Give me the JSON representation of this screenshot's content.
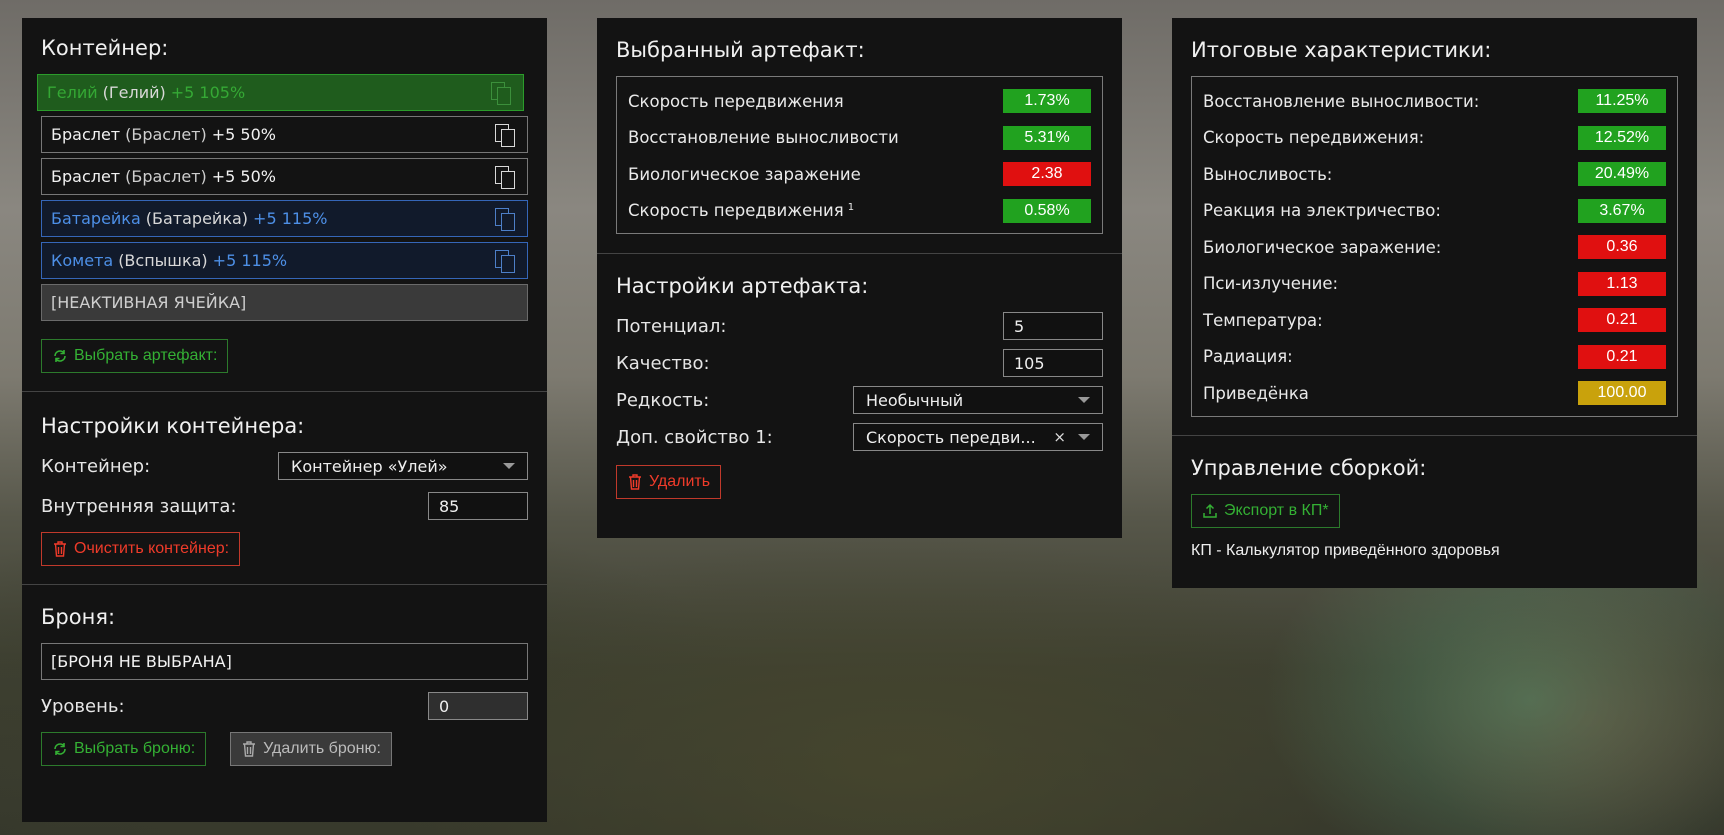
{
  "container_panel": {
    "title": "Контейнер:",
    "slots": [
      {
        "name": "Гелий",
        "sub": "(Гелий)",
        "bonus": "+5 105%",
        "style": "green"
      },
      {
        "name": "Браслет",
        "sub": "(Браслет)",
        "bonus": "+5 50%",
        "style": "plain"
      },
      {
        "name": "Браслет",
        "sub": "(Браслет)",
        "bonus": "+5 50%",
        "style": "plain"
      },
      {
        "name": "Батарейка",
        "sub": "(Батарейка)",
        "bonus": "+5 115%",
        "style": "blue"
      },
      {
        "name": "Комета",
        "sub": "(Вспышка)",
        "bonus": "+5 115%",
        "style": "blue"
      }
    ],
    "inactive_slot": "[НЕАКТИВНАЯ ЯЧЕЙКА]",
    "select_artifact_btn": "Выбрать артефакт:"
  },
  "container_settings": {
    "title": "Настройки контейнера:",
    "container_label": "Контейнер:",
    "container_value": "Контейнер «Улей»",
    "protection_label": "Внутренняя защита:",
    "protection_value": "85",
    "clear_btn": "Очистить контейнер:"
  },
  "armor": {
    "title": "Броня:",
    "armor_value": "[БРОНЯ НЕ ВЫБРАНА]",
    "level_label": "Уровень:",
    "level_value": "0",
    "select_btn": "Выбрать броню:",
    "delete_btn": "Удалить броню:"
  },
  "selected_artifact": {
    "title": "Выбранный артефакт:",
    "stats": [
      {
        "label": "Скорость передвижения",
        "sup": "",
        "value": "1.73%",
        "color": "green"
      },
      {
        "label": "Восстановление выносливости",
        "sup": "",
        "value": "5.31%",
        "color": "green"
      },
      {
        "label": "Биологическое заражение",
        "sup": "",
        "value": "2.38",
        "color": "red"
      },
      {
        "label": "Скорость передвижения",
        "sup": "1",
        "value": "0.58%",
        "color": "green"
      }
    ]
  },
  "artifact_settings": {
    "title": "Настройки артефакта:",
    "potential_label": "Потенциал:",
    "potential_value": "5",
    "quality_label": "Качество:",
    "quality_value": "105",
    "rarity_label": "Редкость:",
    "rarity_value": "Необычный",
    "extra_label": "Доп. свойство 1:",
    "extra_value": "Скорость передви...",
    "extra_clear": "×",
    "delete_btn": "Удалить"
  },
  "totals": {
    "title": "Итоговые характеристики:",
    "stats": [
      {
        "label": "Восстановление выносливости:",
        "value": "11.25%",
        "color": "green"
      },
      {
        "label": "Скорость передвижения:",
        "value": "12.52%",
        "color": "green"
      },
      {
        "label": "Выносливость:",
        "value": "20.49%",
        "color": "green"
      },
      {
        "label": "Реакция на электричество:",
        "value": "3.67%",
        "color": "green"
      },
      {
        "label": "Биологическое заражение:",
        "value": "0.36",
        "color": "red"
      },
      {
        "label": "Пси-излучение:",
        "value": "1.13",
        "color": "red"
      },
      {
        "label": "Температура:",
        "value": "0.21",
        "color": "red"
      },
      {
        "label": "Радиация:",
        "value": "0.21",
        "color": "red"
      },
      {
        "label": "Приведёнка",
        "value": "100.00",
        "color": "yellow"
      }
    ]
  },
  "build_mgmt": {
    "title": "Управление сборкой:",
    "export_btn": "Экспорт в КП*",
    "note": "КП - Калькулятор приведённого здоровья"
  }
}
